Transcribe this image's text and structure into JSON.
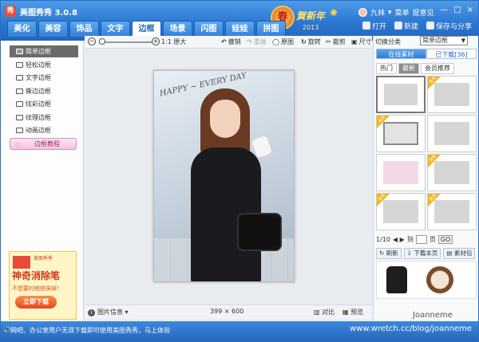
{
  "app": {
    "title": "美图秀秀 3.0.8",
    "logo_glyph": "秀",
    "banner_medal": "春",
    "banner_greeting": "賀新年",
    "banner_year": "2013",
    "user_name": "九林",
    "user_links": [
      "菜单",
      "提意见"
    ],
    "window_controls": [
      "—",
      "□",
      "×"
    ]
  },
  "tabs": [
    "美化",
    "美容",
    "饰品",
    "文字",
    "边框",
    "场景",
    "闪图",
    "娃娃",
    "拼图"
  ],
  "active_tab": "边框",
  "top_actions": [
    {
      "label": "打开",
      "icon": "folder-icon"
    },
    {
      "label": "新建",
      "icon": "plus-icon"
    },
    {
      "label": "保存与分享",
      "icon": "save-icon"
    }
  ],
  "sidebar": {
    "items": [
      {
        "label": "简单边框",
        "active": true
      },
      {
        "label": "轻松边框",
        "active": false
      },
      {
        "label": "文字边框",
        "active": false
      },
      {
        "label": "撕边边框",
        "active": false
      },
      {
        "label": "炫彩边框",
        "active": false
      },
      {
        "label": "纹理边框",
        "active": false
      },
      {
        "label": "动画边框",
        "active": false
      }
    ],
    "tutorial_label": "边框教程",
    "ad": {
      "brand": "美图秀秀",
      "title": "神奇消除笔",
      "subtitle": "不想要的统统抹掉！",
      "button": "立即下载"
    }
  },
  "toolbar": {
    "zoom_out": "−",
    "zoom_in": "+",
    "zoom_level": 0.06,
    "original_size": "1:1 原大",
    "tools": [
      {
        "label": "撤销",
        "glyph": "↶",
        "enabled": true
      },
      {
        "label": "重做",
        "glyph": "↷",
        "enabled": false
      },
      {
        "label": "原图",
        "glyph": "◯",
        "enabled": true
      },
      {
        "label": "旋转",
        "glyph": "↻",
        "enabled": true
      },
      {
        "label": "裁剪",
        "glyph": "✂",
        "enabled": true
      },
      {
        "label": "尺寸",
        "glyph": "▣",
        "enabled": true
      }
    ]
  },
  "canvas": {
    "photo_caption": "HAPPY ~ EVERY DAY"
  },
  "infobar": {
    "image_info": "图片信息 ▾",
    "image_size": "399 × 600",
    "compare": "对比",
    "preview": "预览"
  },
  "rightpanel": {
    "category_label": "切换分类",
    "category_value": "简单边框",
    "tabs": [
      "在线素材",
      "已下载[36]"
    ],
    "active_tab": "在线素材",
    "subtabs": [
      "热门",
      "最新",
      "会员推荐"
    ],
    "active_subtab": "最新",
    "badge_text": "会员",
    "thumbs": [
      {
        "style": "selected",
        "badge": false
      },
      {
        "style": "plain",
        "badge": true
      },
      {
        "style": "ornate",
        "badge": true
      },
      {
        "style": "plain",
        "badge": false
      },
      {
        "style": "pink",
        "badge": false
      },
      {
        "style": "plain",
        "badge": true
      },
      {
        "style": "plain",
        "badge": true
      },
      {
        "style": "plain",
        "badge": true
      }
    ],
    "pager": {
      "page_text": "1/10",
      "nav": "◀ ▶",
      "goto_label": "到",
      "unit": "页",
      "go": "GO"
    },
    "buttons": [
      "刷新",
      "下载本页",
      "素材包"
    ]
  },
  "status": {
    "speaker": "🔊",
    "text": "网吧、办公室用户无须下载即可使用美图秀秀，马上体验",
    "watermark_url": "www.wretch.cc/blog/joanneme",
    "watermark_name": "Joanneme"
  },
  "colors": {
    "accent": "#2a74cf",
    "active_item": "#6b6b6b",
    "badge": "#f2b625"
  }
}
